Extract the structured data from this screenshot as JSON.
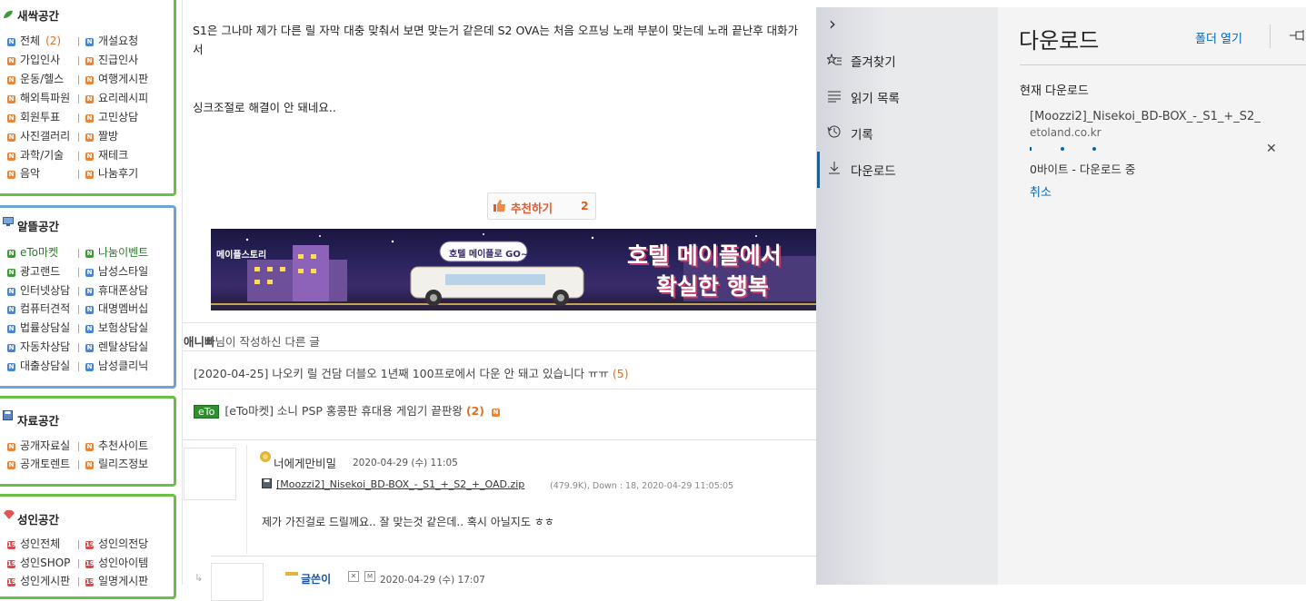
{
  "sidebar": {
    "boxes": [
      {
        "title": "새싹공간",
        "items": [
          {
            "label": "전체",
            "count": "(2)"
          },
          {
            "label": "개설요청"
          },
          {
            "label": "가입인사"
          },
          {
            "label": "진급인사"
          },
          {
            "label": "운동/헬스"
          },
          {
            "label": "여행게시판"
          },
          {
            "label": "해외특파원"
          },
          {
            "label": "요리레시피"
          },
          {
            "label": "회원투표"
          },
          {
            "label": "고민상담"
          },
          {
            "label": "사진갤러리"
          },
          {
            "label": "짤방"
          },
          {
            "label": "과학/기술"
          },
          {
            "label": "재테크"
          },
          {
            "label": "음악"
          },
          {
            "label": "나눔후기"
          }
        ]
      },
      {
        "title": "알뜰공간",
        "items": [
          {
            "label": "eTo마켓"
          },
          {
            "label": "나눔이벤트"
          },
          {
            "label": "광고랜드"
          },
          {
            "label": "남성스타일"
          },
          {
            "label": "인터넷상담"
          },
          {
            "label": "휴대폰상담"
          },
          {
            "label": "컴퓨터견적"
          },
          {
            "label": "대명멤버십"
          },
          {
            "label": "법률상담실"
          },
          {
            "label": "보험상담실"
          },
          {
            "label": "자동차상담"
          },
          {
            "label": "렌탈상담실"
          },
          {
            "label": "대출상담실"
          },
          {
            "label": "남성클리닉"
          }
        ]
      },
      {
        "title": "자료공간",
        "items": [
          {
            "label": "공개자료실"
          },
          {
            "label": "추천사이트"
          },
          {
            "label": "공개토렌트"
          },
          {
            "label": "릴리즈정보"
          }
        ]
      },
      {
        "title": "성인공간",
        "items": [
          {
            "label": "성인전체"
          },
          {
            "label": "성인의전당"
          },
          {
            "label": "성인SHOP"
          },
          {
            "label": "성인아이템"
          },
          {
            "label": "성인게시판"
          },
          {
            "label": "일명게시판"
          }
        ]
      }
    ]
  },
  "post": {
    "line1": "S1은 그나마 제가 다른 릴 자막 대충 맞춰서 보면 맞는거 같은데 S2 OVA는 처음 오프닝 노래 부분이 맞는데 노래 끝난후 대화가",
    "line2": "서",
    "line3": "싱크조절로 해결이 안 돼네요..",
    "recommend_label": "추천하기",
    "recommend_count": "2"
  },
  "banner": {
    "logo": "메이플스토리",
    "bubble": "호텔 메이플로 GO~",
    "headline1": "호텔 메이플에서",
    "headline2": "확실한 행복"
  },
  "other_posts": {
    "author": "애니빠",
    "header_suffix": "님이 작성하신 다른 글",
    "item1": "[2020-04-25] 나오키 릴 건담 더블오 1년째 100프로에서 다운 안 돼고 있습니다 ㅠㅠ",
    "item1_count": "(5)",
    "eto_badge": "eTo",
    "item2": "[eTo마켓] 소니 PSP 홍콩판 휴대용 게임기 끝판왕",
    "item2_count": "(2)"
  },
  "comments": [
    {
      "nick": "너에게만비밀",
      "date": "2020-04-29 (수) 11:05",
      "file": "[Moozzi2]_Nisekoi_BD-BOX_-_S1_+_S2_+_OAD.zip",
      "file_meta": "(479.9K), Down : 18, 2020-04-29 11:05:05",
      "body": "제가 가진걸로 드릴께요.. 잘 맞는것 같은데.. 혹시 아닐지도 ㅎㅎ"
    },
    {
      "nick": "글쓴이",
      "date": "2020-04-29 (수) 17:07"
    }
  ],
  "hub": {
    "collapse_glyph": "›",
    "items": [
      {
        "label": "즐겨찾기",
        "icon": "star-list-icon"
      },
      {
        "label": "읽기 목록",
        "icon": "reading-list-icon"
      },
      {
        "label": "기록",
        "icon": "history-icon"
      },
      {
        "label": "다운로드",
        "icon": "download-icon",
        "active": true
      }
    ]
  },
  "downloads": {
    "title": "다운로드",
    "open_folder": "폴더 열기",
    "section": "현재 다운로드",
    "file_name": "[Moozzi2]_Nisekoi_BD-BOX_-_S1_+_S2_",
    "source": "etoland.co.kr",
    "status": "0바이트 - 다운로드 중",
    "cancel": "취소"
  },
  "colors": {
    "green_border": "#6cbf45",
    "blue_border": "#6fa3d8",
    "accent_blue": "#0067b8",
    "orange": "#e07020"
  }
}
